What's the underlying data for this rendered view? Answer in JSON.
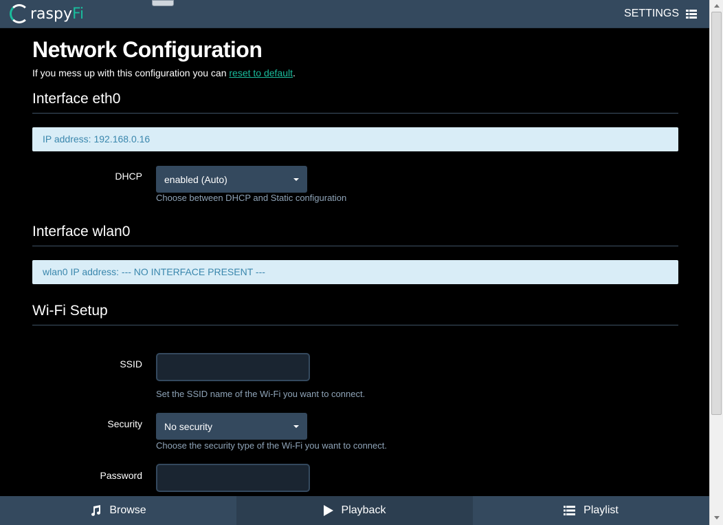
{
  "header": {
    "logo_text_main": "raspy",
    "logo_text_accent": "Fi",
    "settings_label": "SETTINGS"
  },
  "page": {
    "title": "Network Configuration",
    "intro_text": "If you mess up with this configuration you can ",
    "intro_link": "reset to default",
    "intro_end": "."
  },
  "eth0": {
    "heading": "Interface eth0",
    "ip_alert": "IP address: 192.168.0.16",
    "dhcp_label": "DHCP",
    "dhcp_value": "enabled (Auto)",
    "dhcp_help": "Choose between DHCP and Static configuration"
  },
  "wlan0": {
    "heading": "Interface wlan0",
    "ip_alert": "wlan0 IP address: --- NO INTERFACE PRESENT ---"
  },
  "wifi": {
    "heading": "Wi-Fi Setup",
    "ssid_label": "SSID",
    "ssid_value": "",
    "ssid_help": "Set the SSID name of the Wi-Fi you want to connect.",
    "security_label": "Security",
    "security_value": "No security",
    "security_help": "Choose the security type of the Wi-Fi you want to connect.",
    "password_label": "Password",
    "password_value": ""
  },
  "footer": {
    "tabs": [
      {
        "label": "Browse",
        "icon": "music-note-icon"
      },
      {
        "label": "Playback",
        "icon": "play-icon"
      },
      {
        "label": "Playlist",
        "icon": "list-icon"
      }
    ]
  },
  "colors": {
    "bar": "#34495e",
    "accent": "#1abc9c",
    "alert_bg": "#d9edf7",
    "alert_text": "#3a87ad"
  }
}
